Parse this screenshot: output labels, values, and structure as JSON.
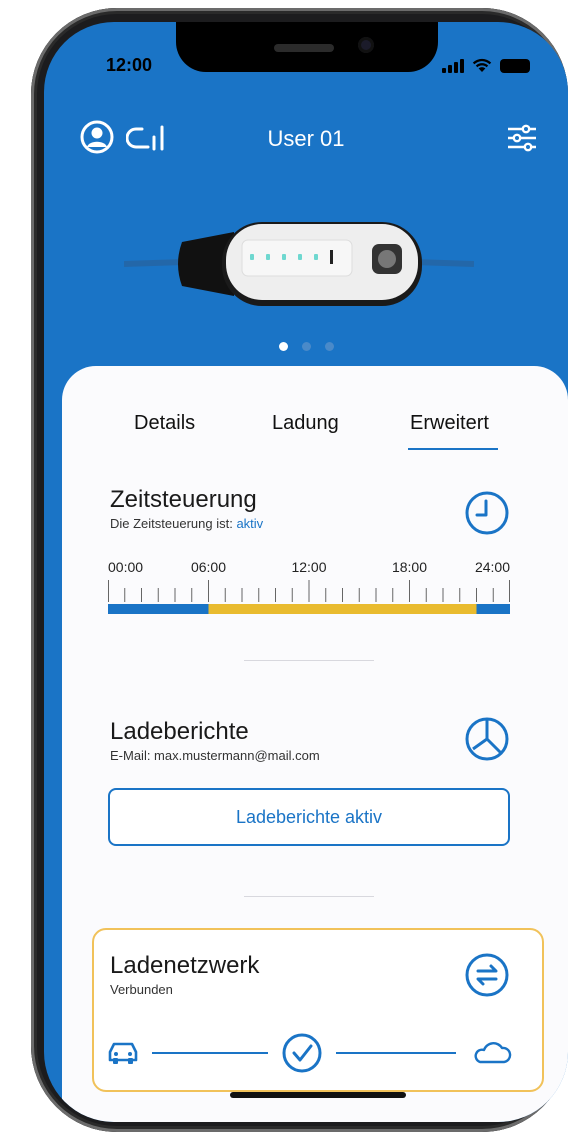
{
  "status_bar": {
    "time": "12:00"
  },
  "header": {
    "title": "User 01",
    "user_icon": "user-circle-icon",
    "logo_icon": "brand-logo-icon",
    "settings_icon": "sliders-icon"
  },
  "device": {
    "image": "charger-device-image"
  },
  "carousel": {
    "count": 3,
    "active_index": 0
  },
  "tabs": [
    {
      "label": "Details",
      "active": false
    },
    {
      "label": "Ladung",
      "active": false
    },
    {
      "label": "Erweitert",
      "active": true
    }
  ],
  "zeitsteuerung": {
    "title": "Zeitsteuerung",
    "subtitle_prefix": "Die Zeitsteuerung ist: ",
    "status": "aktiv",
    "icon": "clock-icon",
    "timeline": {
      "labels": [
        "00:00",
        "06:00",
        "12:00",
        "18:00",
        "24:00"
      ],
      "active_start_hour": 6,
      "active_end_hour": 22,
      "total_hours": 24
    }
  },
  "ladeberichte": {
    "title": "Ladeberichte",
    "subtitle": "E-Mail:  max.mustermann@mail.com",
    "icon": "pie-chart-icon",
    "button_label": "Ladeberichte aktiv"
  },
  "ladenetzwerk": {
    "title": "Ladenetzwerk",
    "subtitle": "Verbunden",
    "icon": "sync-arrows-icon",
    "car_icon": "car-icon",
    "check_icon": "check-circle-icon",
    "cloud_icon": "cloud-icon"
  },
  "colors": {
    "primary": "#1a74c6",
    "timeline_active": "#e9bb2f",
    "network_border": "#f1c25a"
  }
}
